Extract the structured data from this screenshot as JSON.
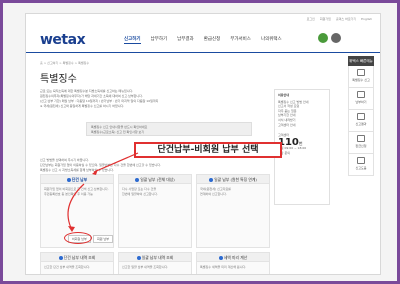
{
  "util_links": [
    "로그인",
    "회원가입",
    "홈택스 바로가기",
    "English"
  ],
  "logo": "wetax",
  "nav": [
    {
      "label": "신고하기",
      "active": true
    },
    {
      "label": "납부하기",
      "active": false
    },
    {
      "label": "납부결과",
      "active": false
    },
    {
      "label": "환급신청",
      "active": false
    },
    {
      "label": "부가서비스",
      "active": false
    },
    {
      "label": "나의위택스",
      "active": false
    }
  ],
  "breadcrumb": "홈 > 신고하기 > 특별징수 > 특별징수",
  "page_title": "특별징수",
  "quick": {
    "header": "위택스 빠른메뉴",
    "items": [
      "특별징수 신고",
      "납부하기",
      "신고결과",
      "환급신청",
      "신고도움"
    ]
  },
  "intro_lines": [
    "근로 또는 퇴직소득에 대한 특별징수분 지방소득세를 신고하는 메뉴입니다.",
    "원천징수의무자(특별징수의무자)가 해당 과세기간 소득에 대하여 신고·납부합니다.",
    "(신고·납부 기한) 매월 납부 : 다음달 10일까지 / 반기납부 : 반기 마지막 달의 다음달 10일까지",
    "※ 국세(원천세) 신고와 동일하게 특별징수 신고를 하시기 바랍니다."
  ],
  "gray_box": [
    "특별징수 신고 안내사항을 반드시 확인하세요",
    "특별징수(근로소득) 신고 전 확인사항 보기"
  ],
  "annotation": "단건납부-비회원 납부 선택",
  "desc_lines": [
    "신고 방법을 선택하여 주시기 바랍니다.",
    "단건납부는 회원가입 없이 이용하실 수 있으며, 일괄납부는 다수 건을 한번에 신고할 수 있습니다.",
    "특별징수 신고 시 지방소득세를 함께 납부하실 수 있습니다."
  ],
  "sidebar": {
    "header": "이용안내",
    "lines": [
      "특별징수 신고 방법 안내",
      "신고서 작성 요령",
      "자주 묻는 질문",
      "납부기한 안내",
      "서식 내려받기",
      "고객센터 안내"
    ],
    "counter_label": "고객센터",
    "counter_value": "110",
    "counter_unit": "번",
    "counter_lines": [
      "평일 09:00 ~ 18:00",
      "상담 문의"
    ]
  },
  "cards": [
    {
      "title": "단건 납부",
      "highlight": true,
      "lines": [
        "회원가입 없이 비회원으로 한 건씩 신고·납부합니다.",
        "주민등록번호 등 본인확인 후 이용 가능"
      ],
      "buttons": [
        "비회원 납부",
        "회원 납부"
      ]
    },
    {
      "title": "일괄 납부 (전체 대상)",
      "highlight": false,
      "lines": [
        "다수 사업장 또는 다수 건을",
        "한번에 일괄하여 신고합니다."
      ],
      "buttons": []
    },
    {
      "title": "일괄 납부 (원천 특징 연계)",
      "highlight": false,
      "lines": [
        "국세(원천세) 신고자료를",
        "연계하여 신고합니다."
      ],
      "buttons": []
    },
    {
      "title": "단건 납부 내역 조회",
      "highlight": false,
      "lines": [
        "신고한 단건 납부 내역을 조회합니다."
      ],
      "buttons": []
    },
    {
      "title": "일괄 납부 내역 조회",
      "highlight": false,
      "lines": [
        "신고한 일괄 납부 내역을 조회합니다."
      ],
      "buttons": []
    },
    {
      "title": "세액 미리 계산",
      "highlight": false,
      "lines": [
        "특별징수 세액을 미리 계산해 봅니다."
      ],
      "buttons": []
    }
  ]
}
